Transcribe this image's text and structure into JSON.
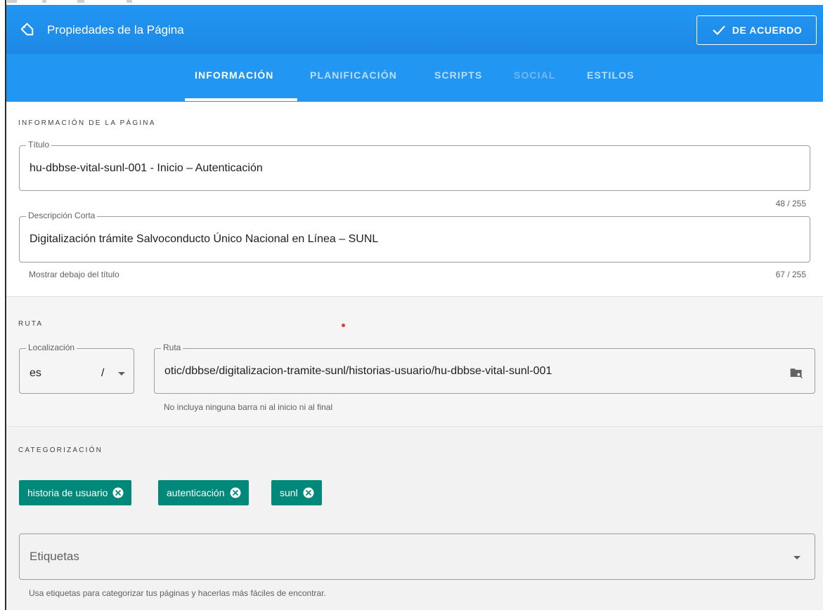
{
  "header": {
    "title": "Propiedades de la Página",
    "ok_label": "DE ACUERDO"
  },
  "tabs": [
    {
      "label": "INFORMACIÓN",
      "state": "active"
    },
    {
      "label": "PLANIFICACIÓN",
      "state": "normal"
    },
    {
      "label": "SCRIPTS",
      "state": "normal"
    },
    {
      "label": "SOCIAL",
      "state": "disabled"
    },
    {
      "label": "ESTILOS",
      "state": "normal"
    }
  ],
  "info": {
    "section_label": "INFORMACIÓN DE LA PÁGINA",
    "title_field": {
      "legend": "Título",
      "value": "hu-dbbse-vital-sunl-001 - Inicio – Autenticación",
      "counter": "48 / 255"
    },
    "description_field": {
      "legend": "Descripción Corta",
      "value": "Digitalización trámite Salvoconducto Único Nacional en Línea – SUNL",
      "hint": "Mostrar debajo del título",
      "counter": "67 / 255"
    }
  },
  "route": {
    "section_label": "RUTA",
    "locale_field": {
      "legend": "Localización",
      "value": "es",
      "separator": "/"
    },
    "path_field": {
      "legend": "Ruta",
      "value": "otic/dbbse/digitalizacion-tramite-sunl/historias-usuario/hu-dbbse-vital-sunl-001",
      "hint": "No incluya ninguna barra ni al inicio ni al final"
    }
  },
  "categorization": {
    "section_label": "CATEGORIZACIÓN",
    "chips": [
      "historia de usuario",
      "autenticación",
      "sunl"
    ],
    "tags_field": {
      "placeholder": "Etiquetas",
      "hint": "Usa etiquetas para categorizar tus páginas y hacerlas más fáciles de encontrar."
    }
  },
  "colors": {
    "header_blue": "#1e88e5",
    "tabs_blue": "#2196f3",
    "chip_teal": "#00897b"
  },
  "icons": {
    "header": "tag-icon",
    "ok": "check-icon",
    "chip_remove": "close-circle-icon",
    "path_browse": "folder-search-icon",
    "dropdown": "caret-down-icon"
  }
}
